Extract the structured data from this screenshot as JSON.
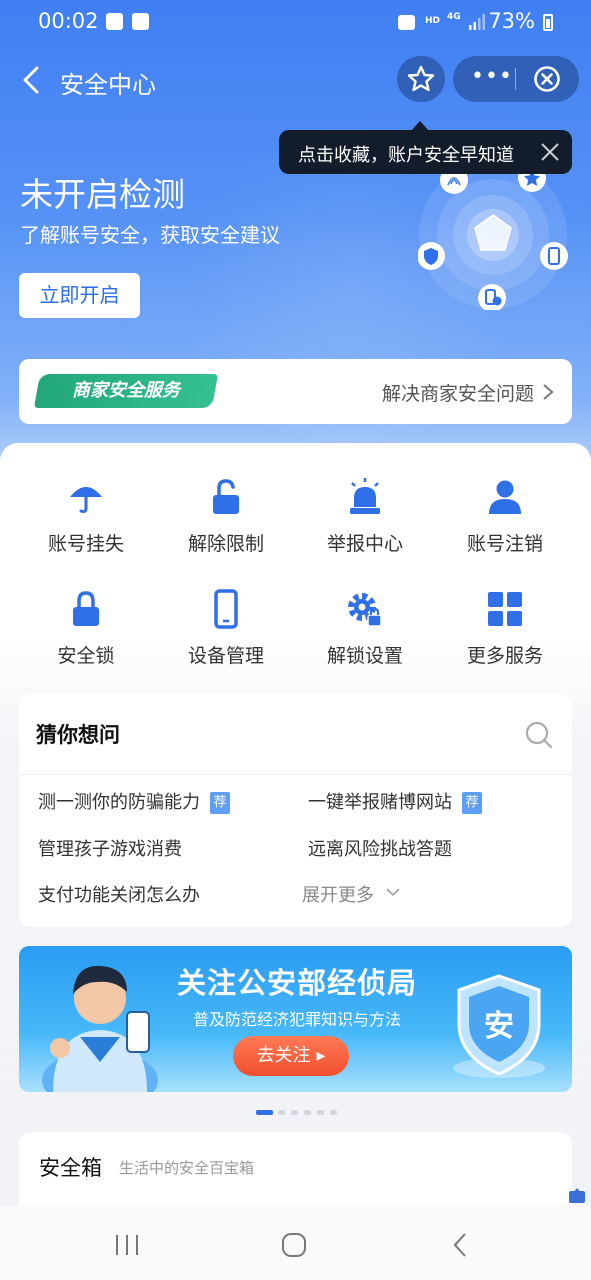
{
  "status_bar": {
    "time": "00:02",
    "network": "4G",
    "hd": "HD",
    "battery": "73%"
  },
  "nav": {
    "title": "安全中心"
  },
  "tooltip": {
    "text": "点击收藏，账户安全早知道"
  },
  "hero": {
    "title": "未开启检测",
    "subtitle": "了解账号安全，获取安全建议",
    "button": "立即开启"
  },
  "merchant": {
    "badge": "商家安全服务",
    "link": "解决商家安全问题"
  },
  "services": [
    {
      "label": "账号挂失",
      "icon": "umbrella-icon"
    },
    {
      "label": "解除限制",
      "icon": "unlock-icon"
    },
    {
      "label": "举报中心",
      "icon": "alarm-icon"
    },
    {
      "label": "账号注销",
      "icon": "user-icon"
    },
    {
      "label": "安全锁",
      "icon": "lock-icon"
    },
    {
      "label": "设备管理",
      "icon": "phone-icon"
    },
    {
      "label": "解锁设置",
      "icon": "gear-lock-icon"
    },
    {
      "label": "更多服务",
      "icon": "grid-icon"
    }
  ],
  "faq": {
    "title": "猜你想问",
    "questions": [
      "测一测你的防骗能力",
      "一键举报赌博网站",
      "管理孩子游戏消费",
      "远离风险挑战答题",
      "支付功能关闭怎么办"
    ],
    "tag": "荐",
    "more": "展开更多"
  },
  "banner": {
    "headline": "关注公安部经侦局",
    "subline": "普及防范经济犯罪知识与方法",
    "button": "去关注",
    "shield_char": "安"
  },
  "carousel": {
    "count": 5,
    "active": 0
  },
  "safebox": {
    "title": "安全箱",
    "subtitle": "生活中的安全百宝箱"
  },
  "colors": {
    "primary_blue": "#2f6fe8",
    "accent_green": "#22a67a",
    "cta_orange": "#f04f2e",
    "tag_blue": "#5e9ef3"
  }
}
